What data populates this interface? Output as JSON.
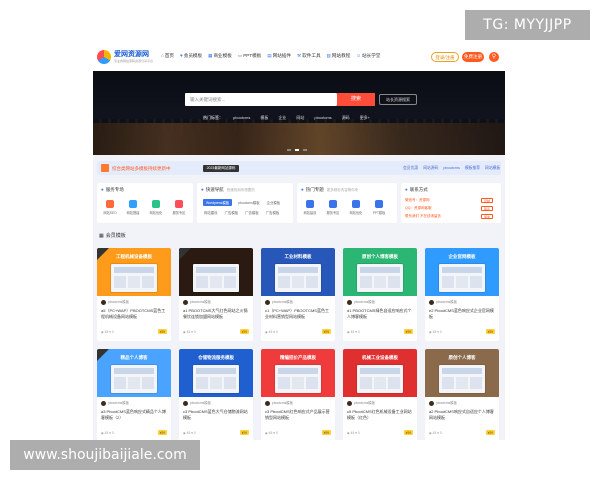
{
  "watermark": {
    "top": "TG: MYYJJPP",
    "bottom": "www.shoujibaijiale.com"
  },
  "header": {
    "logo_text": "爱网资源网",
    "logo_sub": "专业的网站源码资源分享平台",
    "nav": [
      {
        "icon": "home-icon",
        "label": "首页"
      },
      {
        "icon": "heart-icon",
        "label": "会员模板"
      },
      {
        "icon": "grid-icon",
        "label": "商业模板"
      },
      {
        "icon": "monitor-icon",
        "label": "PPT模板"
      },
      {
        "icon": "doc-icon",
        "label": "网站插件"
      },
      {
        "icon": "tool-icon",
        "label": "软件工具"
      },
      {
        "icon": "book-icon",
        "label": "网站教程"
      },
      {
        "icon": "user-icon",
        "label": "站长学堂"
      }
    ],
    "login": "登录/注册",
    "register": "免费注册",
    "search_icon": "search-icon"
  },
  "banner": {
    "search_placeholder": "输入关键词搜索...",
    "search_button": "搜索",
    "search_link": "站长资源搜索",
    "hot": [
      "热门标签：",
      "pbootcms",
      "模板",
      "企业",
      "网站",
      "pbootcms",
      "源码",
      "更多+"
    ],
    "dots": 3
  },
  "notice": {
    "text": "综合类网站多模板持续更新中",
    "tag": "2023最新网站源码",
    "links": [
      "会员优惠",
      "网站源码",
      "pbootcms",
      "模板推荐",
      "网站模板"
    ]
  },
  "panels": [
    {
      "title": "服务专场",
      "sub": "",
      "icons": [
        {
          "label": "网站SEO",
          "color": "#ff6a3d"
        },
        {
          "label": "网站搭建",
          "color": "#2fa0ff"
        },
        {
          "label": "网站优化",
          "color": "#2bc38a"
        },
        {
          "label": "服务专区",
          "color": "#ff4d5a"
        }
      ]
    },
    {
      "title": "快速导航",
      "sub": "快速找到你想要的",
      "tags": [
        "Wordpress模板",
        "pbootcms模板",
        "企业模板",
        "网站建设",
        "广告模板",
        "广告模板",
        "广告模板"
      ]
    },
    {
      "title": "热门专题",
      "sub": "更多精彩内容等你来",
      "icons": [
        {
          "label": "网站建设",
          "color": "#3a74e8"
        },
        {
          "label": "服务专区",
          "color": "#3a74e8"
        },
        {
          "label": "网站优化",
          "color": "#3a74e8"
        },
        {
          "label": "PPT模板",
          "color": "#3a74e8"
        }
      ]
    },
    {
      "title": "联系方式",
      "sub": "",
      "rows": [
        {
          "text": "微信号：资源网",
          "btn": "复制"
        },
        {
          "text": "QQ：资源网客服",
          "btn": "联系"
        },
        {
          "text": "联系我们 不在线请留言",
          "btn": "留言"
        }
      ]
    }
  ],
  "section": {
    "icon": "grid-icon",
    "title": "会员模板"
  },
  "cards": [
    {
      "thumb_title": "工程机械设备模板",
      "bg": "#ff9b1a",
      "corner": true,
      "author": "pbootcms模板",
      "title": "a5（PC+WAP）PBOOTCMS蓝色工程机械设备网站模板",
      "views": "45",
      "likes": "0",
      "price": "¥99"
    },
    {
      "thumb_title": "",
      "bg": "#2a1a12",
      "corner": true,
      "author": "pbootcms模板",
      "title": "a1 PBOOTCMS大气红色网站之火锅餐饮连锁加盟网站模板",
      "views": "45",
      "likes": "0",
      "price": "¥99"
    },
    {
      "thumb_title": "工业材料模板",
      "bg": "#2757b8",
      "corner": false,
      "author": "pbootcms模板",
      "title": "c1（PC+WAP）PBOOTCMS蓝色工业材料营销型网站模板",
      "views": "45",
      "likes": "0",
      "price": "¥99"
    },
    {
      "thumb_title": "原创个人博客模板",
      "bg": "#2bb673",
      "corner": false,
      "author": "pbootcms模板",
      "title": "d1 PBOOTCMS绿色自适应响应式个人博客模板",
      "views": "45",
      "likes": "0",
      "price": "¥99"
    },
    {
      "thumb_title": "企业官网模板",
      "bg": "#2f9bff",
      "corner": false,
      "author": "pbootcms模板",
      "title": "e2 PbootCMS蓝色响应式企业官网模板",
      "views": "45",
      "likes": "0",
      "price": "¥99"
    },
    {
      "thumb_title": "精品个人博客",
      "bg": "#4aa3ff",
      "corner": true,
      "author": "pbootcms模板",
      "title": "a3 PbootCMS蓝色响应式精品个人博客模板（2）",
      "views": "45",
      "likes": "0",
      "price": "¥99"
    },
    {
      "thumb_title": "仓储物流服务模板",
      "bg": "#1f5fd0",
      "corner": false,
      "author": "pbootcms模板",
      "title": "c3 PbootCMS蓝色大气仓储物流网站模板",
      "views": "45",
      "likes": "0",
      "price": "¥99"
    },
    {
      "thumb_title": "精编招价产品模板",
      "bg": "#ef3b3b",
      "corner": false,
      "author": "pbootcms模板",
      "title": "c3 PbootCMS红色响应式产品展示营销型网站模板",
      "views": "45",
      "likes": "0",
      "price": "¥99"
    },
    {
      "thumb_title": "机械工业设备模板",
      "bg": "#e02f2f",
      "corner": false,
      "author": "pbootcms模板",
      "title": "c5 PbootCMS红色机械设备工业网站模板（红色）",
      "views": "45",
      "likes": "0",
      "price": "¥99"
    },
    {
      "thumb_title": "原创个人博客",
      "bg": "#8a6a4a",
      "corner": false,
      "author": "pbootcms模板",
      "title": "a2 PbootCMS响应式自适应个人博客网站模板",
      "views": "45",
      "likes": "0",
      "price": "¥99"
    }
  ],
  "card_labels": {
    "views_icon": "eye-icon",
    "likes_icon": "heart-icon"
  }
}
